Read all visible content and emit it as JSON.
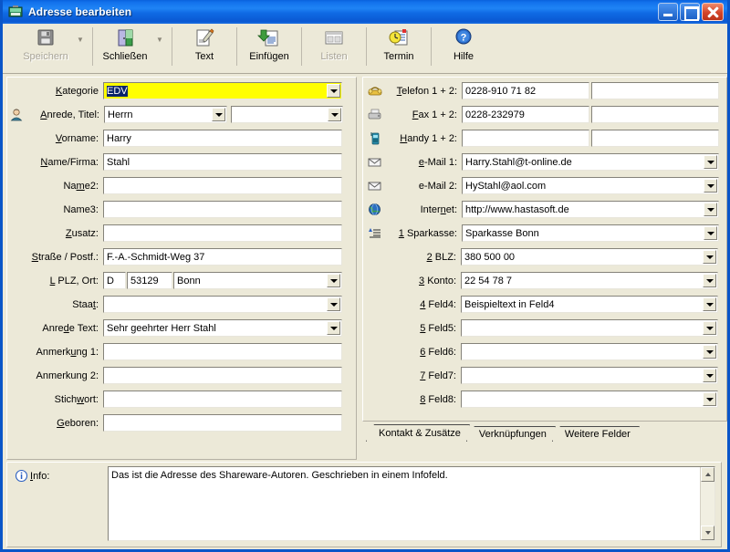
{
  "window": {
    "title": "Adresse bearbeiten",
    "icon": "address-card-icon",
    "minimize_label": "Minimieren",
    "maximize_label": "Maximieren",
    "close_label": "Schließen"
  },
  "toolbar": {
    "items": [
      {
        "label": "Speichern",
        "icon": "save-floppy-icon",
        "disabled": true,
        "has_dropdown": true
      },
      {
        "label": "Schließen",
        "icon": "door-exit-icon",
        "disabled": false,
        "has_dropdown": true
      },
      {
        "label": "Text",
        "icon": "pencil-note-icon",
        "disabled": false,
        "has_dropdown": false
      },
      {
        "label": "Einfügen",
        "icon": "paste-insert-icon",
        "disabled": false,
        "has_dropdown": false
      },
      {
        "label": "Listen",
        "icon": "list-window-icon",
        "disabled": true,
        "has_dropdown": false
      },
      {
        "label": "Termin",
        "icon": "clock-appointment-icon",
        "disabled": false,
        "has_dropdown": false
      },
      {
        "label": "Hilfe",
        "icon": "help-question-icon",
        "disabled": false,
        "has_dropdown": false
      }
    ]
  },
  "left_fields": [
    {
      "label": "Kategorie",
      "underline": "K",
      "icon": null,
      "value": "EDV",
      "type": "combo",
      "highlight": "yellow",
      "selected_text": true
    },
    {
      "label": "Anrede, Titel:",
      "underline": "A",
      "icon": "person-icon",
      "value": "Herrn",
      "type": "combo2",
      "value2": ""
    },
    {
      "label": "Vorname:",
      "underline": "V",
      "icon": null,
      "value": "Harry",
      "type": "text"
    },
    {
      "label": "Name/Firma:",
      "underline": "N",
      "icon": null,
      "value": "Stahl",
      "type": "text"
    },
    {
      "label": "Name2:",
      "underline": "m",
      "icon": null,
      "value": "",
      "type": "text"
    },
    {
      "label": "Name3:",
      "underline": null,
      "icon": null,
      "value": "",
      "type": "text"
    },
    {
      "label": "Zusatz:",
      "underline": "Z",
      "icon": null,
      "value": "",
      "type": "text"
    },
    {
      "label": "Straße / Postf.:",
      "underline": "S",
      "icon": null,
      "value": "F.-A.-Schmidt-Weg 37",
      "type": "text"
    },
    {
      "label": "L PLZ, Ort:",
      "underline": "L",
      "icon": null,
      "value": "D",
      "value2": "53129",
      "value3": "Bonn",
      "type": "plz"
    },
    {
      "label": "Staat:",
      "underline": "t",
      "icon": null,
      "value": "",
      "type": "combo"
    },
    {
      "label": "Anrede Text:",
      "underline": "d",
      "icon": null,
      "value": "Sehr geehrter Herr Stahl",
      "type": "combo"
    },
    {
      "label": "Anmerkung 1:",
      "underline": "u",
      "icon": null,
      "value": "",
      "type": "text"
    },
    {
      "label": "Anmerkung 2:",
      "underline": null,
      "icon": null,
      "value": "",
      "type": "text"
    },
    {
      "label": "Stichwort:",
      "underline": "w",
      "icon": null,
      "value": "",
      "type": "text"
    },
    {
      "label": "Geboren:",
      "underline": "G",
      "icon": null,
      "value": "",
      "type": "text"
    }
  ],
  "right_fields": [
    {
      "label": "Telefon 1 + 2:",
      "underline": "T",
      "icon": "telephone-icon",
      "value": "0228-910 71 82",
      "value2": "",
      "type": "dual"
    },
    {
      "label": "Fax 1 + 2:",
      "underline": "F",
      "icon": "fax-icon",
      "value": "0228-232979",
      "value2": "",
      "type": "dual"
    },
    {
      "label": "Handy 1 + 2:",
      "underline": "H",
      "icon": "mobile-phone-icon",
      "value": "",
      "value2": "",
      "type": "dual"
    },
    {
      "label": "e-Mail 1:",
      "underline": "e",
      "icon": "envelope-icon",
      "value": "Harry.Stahl@t-online.de",
      "type": "combo"
    },
    {
      "label": "e-Mail 2:",
      "underline": null,
      "icon": "envelope-icon",
      "value": "HyStahl@aol.com",
      "type": "combo"
    },
    {
      "label": "Internet:",
      "underline": "n",
      "icon": "globe-icon",
      "value": "http://www.hastasoft.de",
      "type": "combo"
    },
    {
      "label": "1 Sparkasse:",
      "underline": "1",
      "icon": "bank-list-icon",
      "value": "Sparkasse Bonn",
      "type": "combo"
    },
    {
      "label": "2 BLZ:",
      "underline": "2",
      "icon": null,
      "value": "380 500 00",
      "type": "combo"
    },
    {
      "label": "3 Konto:",
      "underline": "3",
      "icon": null,
      "value": "22 54 78 7",
      "type": "combo"
    },
    {
      "label": "4 Feld4:",
      "underline": "4",
      "icon": null,
      "value": "Beispieltext in Feld4",
      "type": "combo"
    },
    {
      "label": "5 Feld5:",
      "underline": "5",
      "icon": null,
      "value": "",
      "type": "combo"
    },
    {
      "label": "6 Feld6:",
      "underline": "6",
      "icon": null,
      "value": "",
      "type": "combo"
    },
    {
      "label": "7 Feld7:",
      "underline": "7",
      "icon": null,
      "value": "",
      "type": "combo"
    },
    {
      "label": "8 Feld8:",
      "underline": "8",
      "icon": null,
      "value": "",
      "type": "combo"
    }
  ],
  "tabs": [
    {
      "label": "Kontakt & Zusätze",
      "active": true
    },
    {
      "label": "Verknüpfungen",
      "active": false
    },
    {
      "label": "Weitere Felder",
      "active": false
    }
  ],
  "info": {
    "label": "Info:",
    "underline": "I",
    "icon": "info-circle-icon",
    "text": "Das ist die Adresse des Shareware-Autoren. Geschrieben in einem Infofeld.",
    "scroll_up": "▲",
    "scroll_down": "▼"
  },
  "colors": {
    "title_bar": "#0a5fd8",
    "client": "#ece9d8",
    "highlight_field": "#ffff00",
    "selection": "#0a246a",
    "field_bg": "#ffffff",
    "border": "#85837a"
  }
}
